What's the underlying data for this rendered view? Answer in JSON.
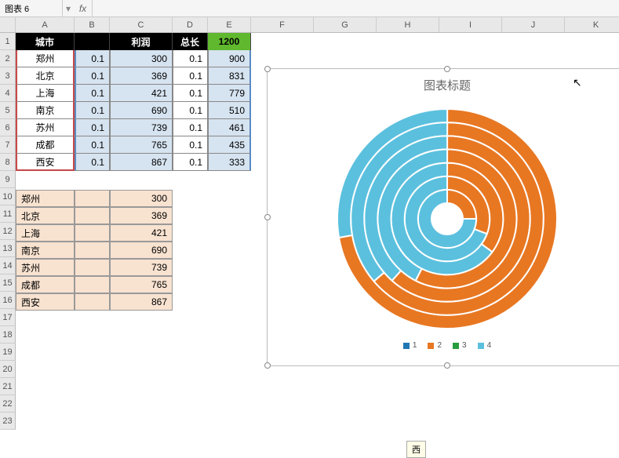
{
  "formula_bar": {
    "namebox": "图表 6",
    "fx_label": "fx"
  },
  "columns": [
    "",
    "A",
    "B",
    "C",
    "D",
    "E",
    "F",
    "G",
    "H",
    "I",
    "J",
    "K"
  ],
  "row_labels": [
    "1",
    "2",
    "3",
    "4",
    "5",
    "6",
    "7",
    "8",
    "9",
    "10",
    "11",
    "12",
    "13",
    "14",
    "15",
    "16",
    "17",
    "18",
    "19",
    "20",
    "21",
    "22",
    "23"
  ],
  "table1": {
    "headers": {
      "a": "城市",
      "b": "",
      "c": "利润",
      "d": "总长",
      "e": "1200"
    },
    "rows": [
      {
        "city": "郑州",
        "b": "0.1",
        "c": "300",
        "d": "0.1",
        "e": "900"
      },
      {
        "city": "北京",
        "b": "0.1",
        "c": "369",
        "d": "0.1",
        "e": "831"
      },
      {
        "city": "上海",
        "b": "0.1",
        "c": "421",
        "d": "0.1",
        "e": "779"
      },
      {
        "city": "南京",
        "b": "0.1",
        "c": "690",
        "d": "0.1",
        "e": "510"
      },
      {
        "city": "苏州",
        "b": "0.1",
        "c": "739",
        "d": "0.1",
        "e": "461"
      },
      {
        "city": "成都",
        "b": "0.1",
        "c": "765",
        "d": "0.1",
        "e": "435"
      },
      {
        "city": "西安",
        "b": "0.1",
        "c": "867",
        "d": "0.1",
        "e": "333"
      }
    ]
  },
  "table2": {
    "rows": [
      {
        "city": "郑州",
        "val": "300"
      },
      {
        "city": "北京",
        "val": "369"
      },
      {
        "city": "上海",
        "val": "421"
      },
      {
        "city": "南京",
        "val": "690"
      },
      {
        "city": "苏州",
        "val": "739"
      },
      {
        "city": "成都",
        "val": "765"
      },
      {
        "city": "西安",
        "val": "867"
      }
    ]
  },
  "chart": {
    "title": "图表标题",
    "legend": [
      {
        "label": "1",
        "color": "#1f77b4"
      },
      {
        "label": "2",
        "color": "#e87722"
      },
      {
        "label": "3",
        "color": "#2a9d3e"
      },
      {
        "label": "4",
        "color": "#5bc0de"
      }
    ]
  },
  "chart_data": {
    "type": "pie",
    "title": "图表标题",
    "note": "Nested doughnut (rose / multi-ring). Each ring is one city; segments per ring are the four series columns B,C,D,E which sum to 1200.",
    "total": 1200,
    "categories": [
      "郑州",
      "北京",
      "上海",
      "南京",
      "苏州",
      "成都",
      "西安"
    ],
    "series": [
      {
        "name": "1",
        "values": [
          0.1,
          0.1,
          0.1,
          0.1,
          0.1,
          0.1,
          0.1
        ],
        "color": "#1f77b4"
      },
      {
        "name": "2",
        "values": [
          300,
          369,
          421,
          690,
          739,
          765,
          867
        ],
        "color": "#e87722"
      },
      {
        "name": "3",
        "values": [
          0.1,
          0.1,
          0.1,
          0.1,
          0.1,
          0.1,
          0.1
        ],
        "color": "#2a9d3e"
      },
      {
        "name": "4",
        "values": [
          900,
          831,
          779,
          510,
          461,
          435,
          333
        ],
        "color": "#5bc0de"
      }
    ]
  },
  "tooltip_text": "西"
}
